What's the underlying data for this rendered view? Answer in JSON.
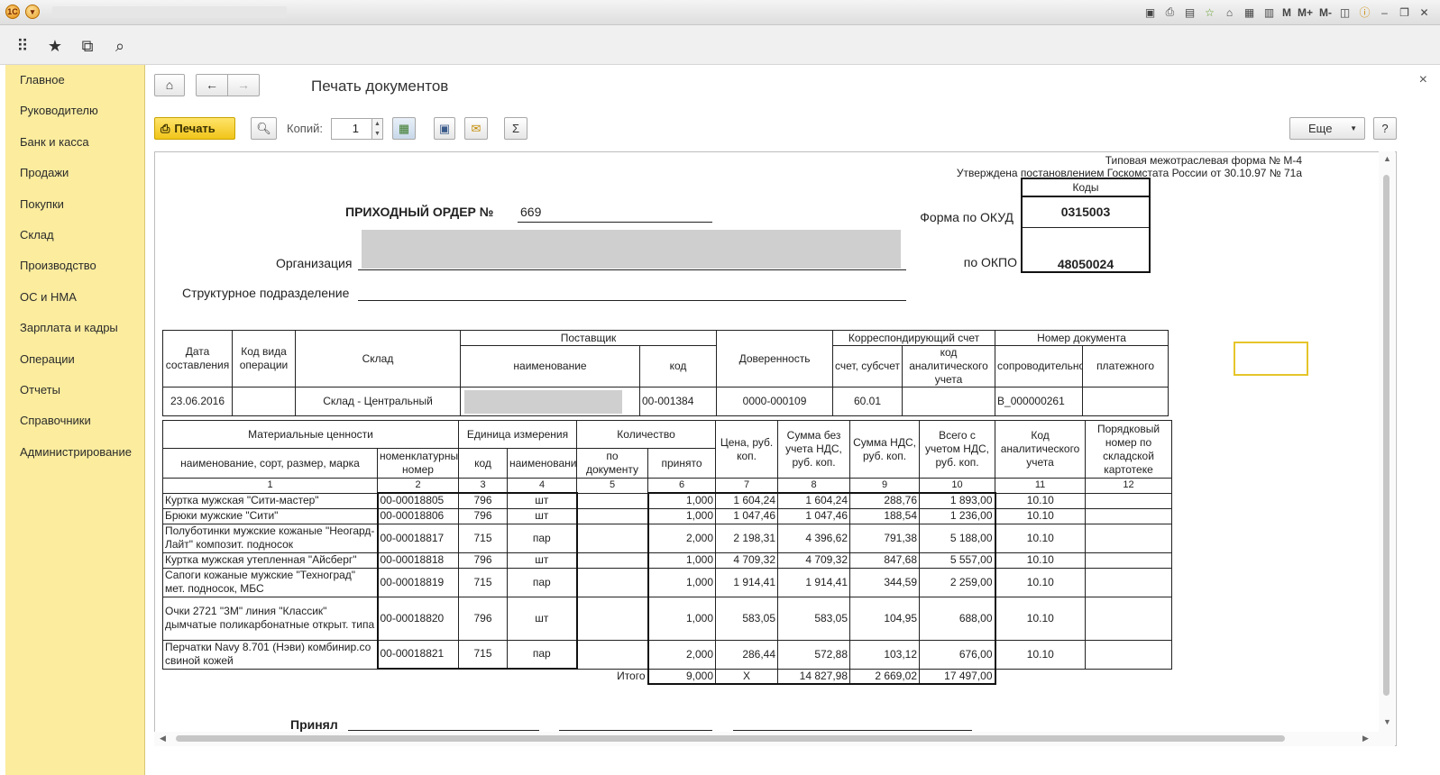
{
  "window": {
    "app_icon_label": "1С"
  },
  "sidebar": {
    "items": [
      {
        "label": "Главное"
      },
      {
        "label": "Руководителю"
      },
      {
        "label": "Банк и касса"
      },
      {
        "label": "Продажи"
      },
      {
        "label": "Покупки"
      },
      {
        "label": "Склад"
      },
      {
        "label": "Производство"
      },
      {
        "label": "ОС и НМА"
      },
      {
        "label": "Зарплата и кадры"
      },
      {
        "label": "Операции"
      },
      {
        "label": "Отчеты"
      },
      {
        "label": "Справочники"
      },
      {
        "label": "Администрирование"
      }
    ]
  },
  "titlebar_right": {
    "m": "M",
    "mplus": "M+",
    "mminus": "M-"
  },
  "page": {
    "title": "Печать документов",
    "close": "×"
  },
  "toolbar": {
    "print_label": "Печать",
    "copies_label": "Копий:",
    "copies_value": "1",
    "sum_label": "Σ",
    "more_label": "Еще",
    "help_label": "?"
  },
  "document": {
    "form_note_1": "Типовая межотраслевая форма № М-4",
    "form_note_2": "Утверждена постановлением Госкомстата России от 30.10.97 № 71а",
    "codes_header": "Коды",
    "okud_label": "Форма по ОКУД",
    "okud_value": "0315003",
    "okpo_label": "по ОКПО",
    "okpo_value": "48050024",
    "order_title": "ПРИХОДНЫЙ ОРДЕР №",
    "order_number": "669",
    "org_label": "Организация",
    "dept_label": "Структурное подразделение",
    "header_table": {
      "col_date": "Дата составления",
      "col_optype": "Код вида операции",
      "col_warehouse": "Склад",
      "col_supplier": "Поставщик",
      "col_supplier_name": "наименование",
      "col_supplier_code": "код",
      "col_proxy": "Доверенность",
      "col_corr_account": "Корреспондирующий счет",
      "col_account": "счет, субсчет",
      "col_analytic": "код аналитического учета",
      "col_doc_number": "Номер документа",
      "col_accompanying": "сопроводительного",
      "col_payment": "платежного",
      "date": "23.06.2016",
      "optype": "",
      "warehouse": "Склад - Центральный",
      "supplier_code": "00-001384",
      "proxy": "0000-000109",
      "account": "60.01",
      "analytic": "",
      "accompanying": "В_000000261",
      "payment": ""
    },
    "items_table": {
      "h_material": "Материальные ценности",
      "h_unit": "Единица измерения",
      "h_qty": "Количество",
      "h_price": "Цена, руб. коп.",
      "h_sum_wo_vat": "Сумма без учета НДС, руб. коп.",
      "h_vat": "Сумма НДС, руб. коп.",
      "h_total": "Всего с учетом НДС, руб. коп.",
      "h_analytic": "Код аналитического учета",
      "h_card": "Порядковый номер по складской картотеке",
      "h_name": "наименование, сорт, размер, марка",
      "h_nomen": "номенклатурный номер",
      "h_unit_code": "код",
      "h_unit_name": "наименование",
      "h_by_doc": "по документу",
      "h_accepted": "принято",
      "col_numbers": [
        "1",
        "2",
        "3",
        "4",
        "5",
        "6",
        "7",
        "8",
        "9",
        "10",
        "11",
        "12"
      ],
      "rows": [
        {
          "name": "Куртка мужская \"Сити-мастер\"",
          "nomen": "00-00018805",
          "code": "796",
          "unit": "шт",
          "doc": "",
          "accepted": "1,000",
          "price": "1 604,24",
          "sum": "1 604,24",
          "vat": "288,76",
          "total": "1 893,00",
          "analytic": "10.10",
          "card": ""
        },
        {
          "name": "Брюки мужские \"Сити\"",
          "nomen": "00-00018806",
          "code": "796",
          "unit": "шт",
          "doc": "",
          "accepted": "1,000",
          "price": "1 047,46",
          "sum": "1 047,46",
          "vat": "188,54",
          "total": "1 236,00",
          "analytic": "10.10",
          "card": ""
        },
        {
          "name": "Полуботинки мужские кожаные \"Неогард-Лайт\" композит. подносок",
          "nomen": "00-00018817",
          "code": "715",
          "unit": "пар",
          "doc": "",
          "accepted": "2,000",
          "price": "2 198,31",
          "sum": "4 396,62",
          "vat": "791,38",
          "total": "5 188,00",
          "analytic": "10.10",
          "card": ""
        },
        {
          "name": "Куртка мужская утепленная \"Айсберг\"",
          "nomen": "00-00018818",
          "code": "796",
          "unit": "шт",
          "doc": "",
          "accepted": "1,000",
          "price": "4 709,32",
          "sum": "4 709,32",
          "vat": "847,68",
          "total": "5 557,00",
          "analytic": "10.10",
          "card": ""
        },
        {
          "name": "Сапоги кожаные мужские \"Техноград\" мет. подносок, МБС",
          "nomen": "00-00018819",
          "code": "715",
          "unit": "пар",
          "doc": "",
          "accepted": "1,000",
          "price": "1 914,41",
          "sum": "1 914,41",
          "vat": "344,59",
          "total": "2 259,00",
          "analytic": "10.10",
          "card": ""
        },
        {
          "name": "Очки  2721 \"3М\" линия \"Классик\" дымчатые поликарбонатные открыт. типа",
          "nomen": "00-00018820",
          "code": "796",
          "unit": "шт",
          "doc": "",
          "accepted": "1,000",
          "price": "583,05",
          "sum": "583,05",
          "vat": "104,95",
          "total": "688,00",
          "analytic": "10.10",
          "card": ""
        },
        {
          "name": "Перчатки Navy 8.701 (Нэви) комбинир.со свиной кожей",
          "nomen": "00-00018821",
          "code": "715",
          "unit": "пар",
          "doc": "",
          "accepted": "2,000",
          "price": "286,44",
          "sum": "572,88",
          "vat": "103,12",
          "total": "676,00",
          "analytic": "10.10",
          "card": ""
        }
      ],
      "total_label": "Итого",
      "total_accepted": "9,000",
      "total_price": "Х",
      "total_sum": "14 827,98",
      "total_vat": "2 669,02",
      "total_all": "17 497,00"
    },
    "accepted_label": "Принял"
  }
}
